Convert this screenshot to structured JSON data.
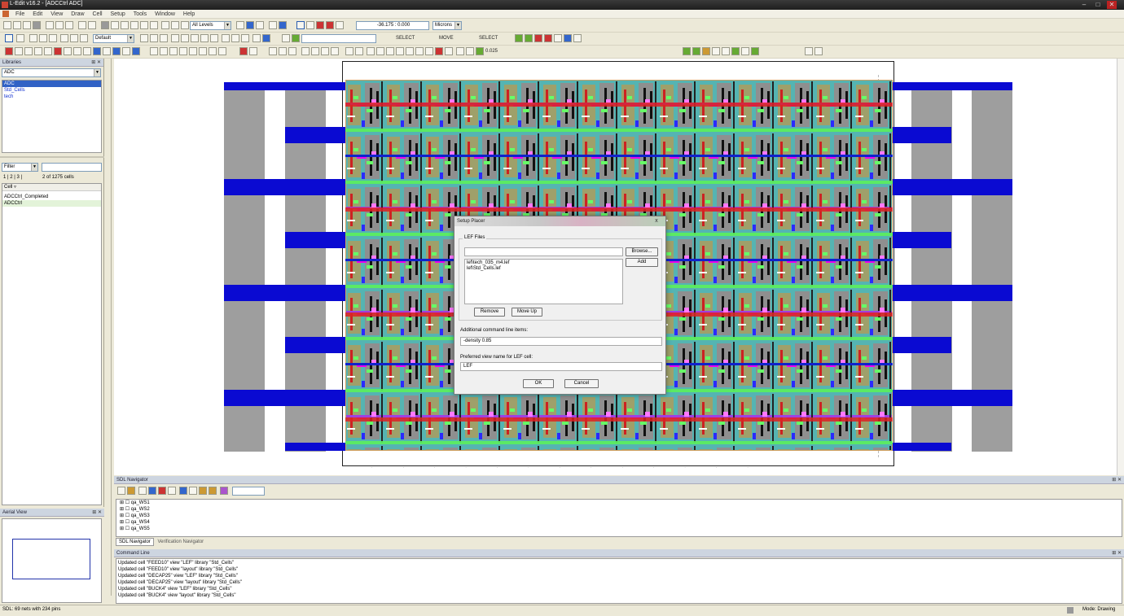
{
  "title_bar": {
    "title": "L-Edit v16.2 - [ADCCtrl    ADC]",
    "minimize": "–",
    "restore": "□",
    "close": "✕"
  },
  "menu": {
    "items": [
      "File",
      "Edit",
      "View",
      "Draw",
      "Cell",
      "Setup",
      "Tools",
      "Window",
      "Help"
    ]
  },
  "toolbar": {
    "layer_mode": "All Levels",
    "coordinate": "-36.175 : 0.000",
    "units": "Microns",
    "default_layer": "Default",
    "select_label_1": "SELECT",
    "move_label": "MOVE",
    "select_label_2": "SELECT",
    "zoom_value": "0.025"
  },
  "libraries_panel": {
    "title": "Libraries",
    "selected_library": "ADC",
    "items": [
      "ADC",
      "Std_Cells",
      "tech"
    ],
    "filter_label": "Filter",
    "filter_value": "",
    "tabs": [
      "1",
      "2",
      "3"
    ],
    "cells_count": "2 of 1275 cells",
    "cell_header": "Cell",
    "cells": [
      "ADCCtrl_Completed",
      "ADCCtrl"
    ]
  },
  "aerial_view": {
    "title": "Aerial View"
  },
  "sdl_navigator": {
    "title": "SDL Navigator",
    "search_value": "",
    "items": [
      "qa_WS1",
      "qa_WS2",
      "qa_WS3",
      "qa_WS4",
      "qa_WS5"
    ],
    "tabs": [
      "SDL Navigator",
      "Verification Navigator"
    ]
  },
  "command_line": {
    "title": "Command Line",
    "lines": [
      "Updated cell \"FEED10\" view \"LEF\" library \"Std_Cells\"",
      "Updated cell \"FEED10\" view \"layout\" library \"Std_Cells\"",
      "Updated cell \"DECAP25\" view \"LEF\" library \"Std_Cells\"",
      "Updated cell \"DECAP25\" view \"layout\" library \"Std_Cells\"",
      "Updated cell \"BUCK4\" view \"LEF\" library \"Std_Cells\"",
      "Updated cell \"BUCK4\" view \"layout\" library \"Std_Cells\""
    ]
  },
  "dialog": {
    "title": "Setup Placer",
    "close": "x",
    "lef_group_label": "LEF Files",
    "lef_path_value": "",
    "browse_label": "Browse...",
    "add_label": "Add",
    "lef_files": [
      "lef\\tech_035_m4.lef",
      "lef\\Std_Cells.lef"
    ],
    "remove_label": "Remove",
    "move_up_label": "Move Up",
    "additional_label": "Additional command line items:",
    "additional_value": "-density 0.85",
    "view_name_label": "Preferred view name for LEF cell:",
    "view_name_value": "LEF",
    "ok_label": "OK",
    "cancel_label": "Cancel"
  },
  "status_bar": {
    "left": "SDL: 69 nets with 234 pins",
    "mode": "Mode: Drawing"
  },
  "colors": {
    "rail": "#0a0ad2",
    "core": "#55b4b2",
    "selection": "#3162c5"
  }
}
